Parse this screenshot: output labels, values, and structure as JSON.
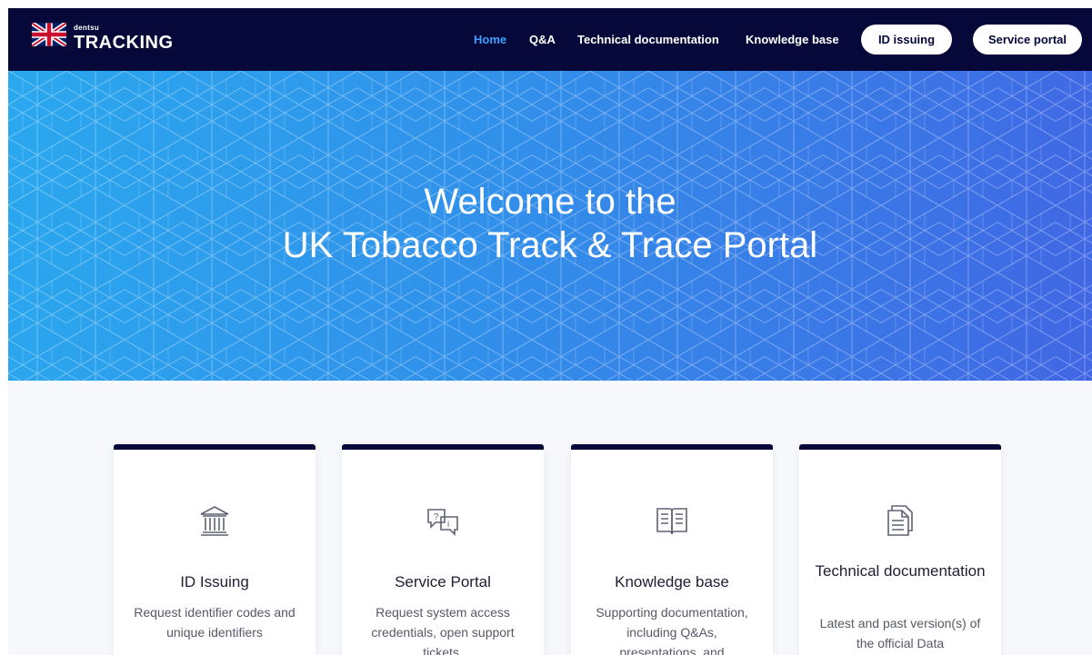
{
  "header": {
    "brand_small": "dentsu",
    "brand_name": "TRACKING",
    "nav": [
      {
        "label": "Home",
        "active": true
      },
      {
        "label": "Q&A"
      },
      {
        "label": "Technical documentation"
      },
      {
        "label": "Knowledge base"
      }
    ],
    "buttons": {
      "id_issuing": "ID issuing",
      "service_portal": "Service portal"
    }
  },
  "hero": {
    "line1": "Welcome to the",
    "line2": "UK Tobacco Track & Trace Portal"
  },
  "cards": [
    {
      "icon": "bank-icon",
      "title": "ID Issuing",
      "description": "Request identifier codes and unique identifiers"
    },
    {
      "icon": "chat-help-icon",
      "title": "Service Portal",
      "description": "Request system access credentials, open support tickets."
    },
    {
      "icon": "book-icon",
      "title": "Knowledge base",
      "description": "Supporting documentation, including Q&As, presentations, and"
    },
    {
      "icon": "document-icon",
      "title": "Technical documentation",
      "description": "Latest and past version(s) of the official Data"
    }
  ],
  "colors": {
    "nav_bg": "#050838",
    "accent": "#3da0ff",
    "hero_start": "#2aa8ee",
    "hero_end": "#4166e4"
  }
}
